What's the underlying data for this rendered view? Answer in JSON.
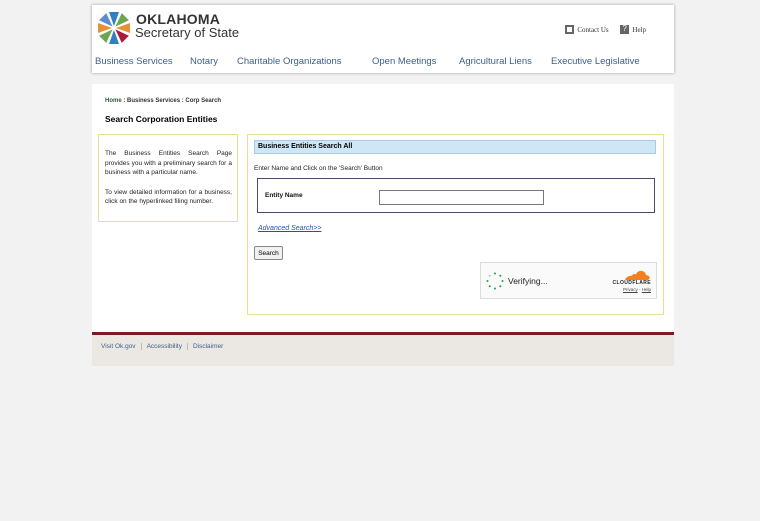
{
  "header": {
    "logo_title": "OKLAHOMA",
    "logo_subtitle": "Secretary of State",
    "contact_label": "Contact Us",
    "help_label": "Help"
  },
  "nav": {
    "items": [
      "Business Services",
      "Notary",
      "Charitable Organizations",
      "Open Meetings",
      "Agricultural Liens",
      "Executive Legislative"
    ]
  },
  "breadcrumb": {
    "home": "Home",
    "sep1": " : ",
    "section": "Business Services",
    "sep2": " : ",
    "current": "Corp Search"
  },
  "page_title": "Search Corporation Entities",
  "info": {
    "paragraph1": "The Business Entities Search Page provides you with a preliminary search for a business with a particular name.",
    "paragraph2": "To view detailed information for a business, click on the hyperlinked filing number."
  },
  "search": {
    "panel_title": "Business Entities Search All",
    "instruction": "Enter Name and Click on the 'Search' Button",
    "entity_name_label": "Entity Name",
    "entity_name_value": "",
    "advanced_link": "Advanced Search>>",
    "search_button": "Search"
  },
  "captcha": {
    "status": "Verifying...",
    "brand": "CLOUDFLARE",
    "privacy": "Privacy",
    "separator": " - ",
    "help": "Help",
    "colors": {
      "cloud": "#f38020",
      "spinner": "#1aa34a"
    }
  },
  "footer": {
    "links": [
      "Visit Ok.gov",
      "Accessibility",
      "Disclaimer"
    ]
  },
  "colors": {
    "nav_text": "#3d5f87",
    "footer_bar": "#7a1c24",
    "panel_border": "#e3e09a",
    "panel_title_bg": "#cfe6f7"
  }
}
